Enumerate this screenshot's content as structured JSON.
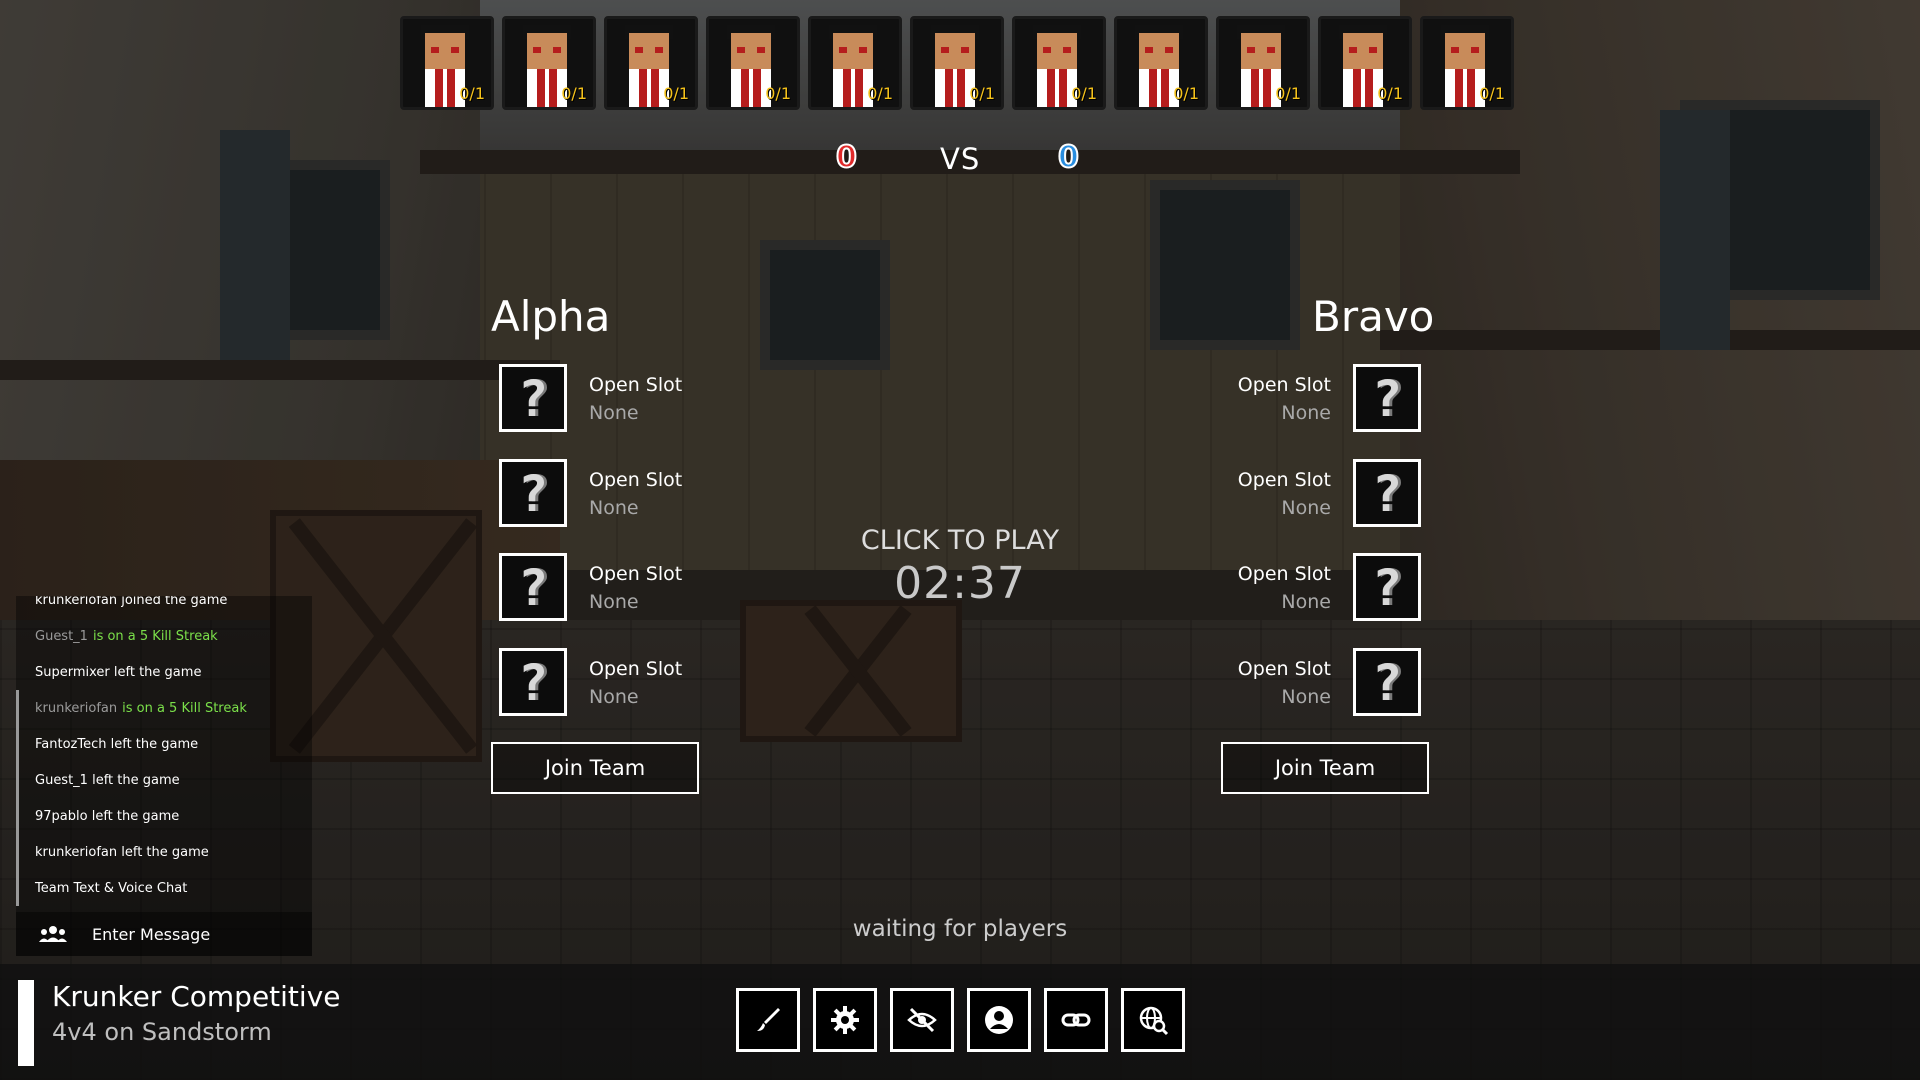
{
  "players": [
    {
      "score": "0/1"
    },
    {
      "score": "0/1"
    },
    {
      "score": "0/1"
    },
    {
      "score": "0/1"
    },
    {
      "score": "0/1"
    },
    {
      "score": "0/1"
    },
    {
      "score": "0/1"
    },
    {
      "score": "0/1"
    },
    {
      "score": "0/1"
    },
    {
      "score": "0/1"
    },
    {
      "score": "0/1"
    }
  ],
  "score": {
    "alpha": "0",
    "vs": "VS",
    "bravo": "0"
  },
  "alpha": {
    "title": "Alpha",
    "slots": [
      {
        "name": "Open Slot",
        "sub": "None"
      },
      {
        "name": "Open Slot",
        "sub": "None"
      },
      {
        "name": "Open Slot",
        "sub": "None"
      },
      {
        "name": "Open Slot",
        "sub": "None"
      }
    ],
    "join_label": "Join Team"
  },
  "bravo": {
    "title": "Bravo",
    "slots": [
      {
        "name": "Open Slot",
        "sub": "None"
      },
      {
        "name": "Open Slot",
        "sub": "None"
      },
      {
        "name": "Open Slot",
        "sub": "None"
      },
      {
        "name": "Open Slot",
        "sub": "None"
      }
    ],
    "join_label": "Join Team"
  },
  "center": {
    "click_to_play": "CLICK TO PLAY",
    "timer": "02:37",
    "waiting": "waiting for players"
  },
  "chat": {
    "messages": [
      {
        "who": "",
        "text": "krunkeriofan joined the game"
      },
      {
        "who": "Guest_1",
        "text": "is on a 5 Kill Streak"
      },
      {
        "who": "",
        "text": "Supermixer left the game"
      },
      {
        "who": "krunkeriofan",
        "text": "is on a 5 Kill Streak"
      },
      {
        "who": "",
        "text": "FantozTech left the game"
      },
      {
        "who": "",
        "text": "Guest_1 left the game"
      },
      {
        "who": "",
        "text": "97pablo left the game"
      },
      {
        "who": "",
        "text": "krunkeriofan left the game"
      },
      {
        "who": "",
        "text": "Team Text & Voice Chat"
      }
    ],
    "input_placeholder": "Enter Message"
  },
  "footer": {
    "title": "Krunker Competitive",
    "mode": "4v4",
    "map_prefix": "on Sandstorm"
  },
  "tools": [
    {
      "icon": "paintbrush-icon"
    },
    {
      "icon": "gear-icon"
    },
    {
      "icon": "eye-slash-icon"
    },
    {
      "icon": "user-circle-icon"
    },
    {
      "icon": "link-icon"
    },
    {
      "icon": "search-globe-icon"
    }
  ],
  "colors": {
    "alpha": "#e02a2a",
    "bravo": "#2a8ee0",
    "streak": "#7be04a",
    "score_text": "#f5c21a"
  }
}
